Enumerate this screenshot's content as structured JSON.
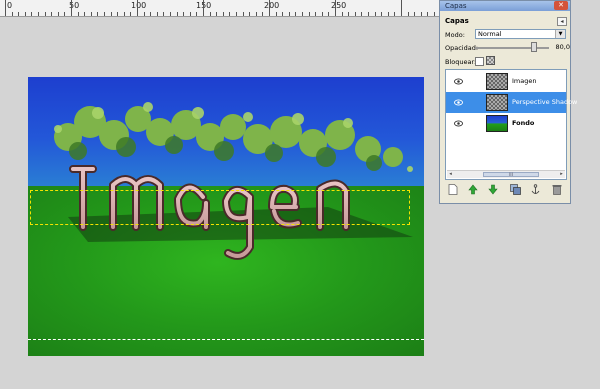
{
  "ruler": {
    "labels": [
      "0",
      "50",
      "100",
      "150",
      "200",
      "250"
    ]
  },
  "canvas": {
    "text_art": "imagen"
  },
  "dialog": {
    "window_title": "Capas",
    "close_glyph": "✕",
    "menu_glyph": "◂",
    "title": "Capas",
    "mode_label": "Modo:",
    "mode_value": "Normal",
    "opacity_label": "Opacidad:",
    "opacity_value": "80,0",
    "opacity_fraction": 0.8,
    "lock_label": "Bloquear:",
    "layers": [
      {
        "name": "Imagen",
        "selected": false,
        "thumb": "checker"
      },
      {
        "name": "Perspective Shadow",
        "selected": true,
        "thumb": "checker"
      },
      {
        "name": "Fondo",
        "selected": false,
        "thumb": "background"
      }
    ],
    "scroll_grip": "III",
    "toolbar": {
      "new_icon": "new-layer-icon",
      "raise_icon": "raise-layer-icon",
      "lower_icon": "lower-layer-icon",
      "duplicate_icon": "duplicate-layer-icon",
      "anchor_icon": "anchor-layer-icon",
      "delete_icon": "delete-layer-icon"
    }
  },
  "colors": {
    "sky": "#1d3fcf",
    "grass": "#23981a",
    "selection": "#3d8ee8"
  }
}
